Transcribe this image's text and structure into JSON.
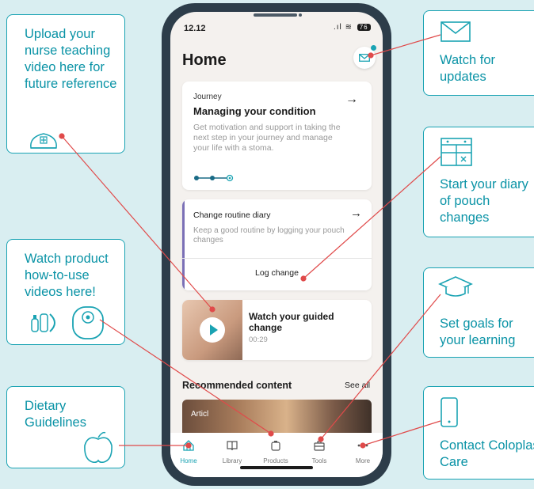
{
  "phone": {
    "status_time": "12.12",
    "battery": "76",
    "page_title": "Home",
    "journey_card": {
      "label": "Journey",
      "title": "Managing your condition",
      "description": "Get motivation and support in taking the next step in your journey and manage your life with a stoma."
    },
    "diary_card": {
      "title": "Change routine diary",
      "description": "Keep a good routine by logging your pouch changes",
      "action": "Log change"
    },
    "video_card": {
      "title": "Watch your guided change",
      "duration": "00:29"
    },
    "recommended": {
      "title": "Recommended content",
      "see_all": "See all",
      "item_label": "Articl"
    },
    "tabs": [
      "Home",
      "Library",
      "Products",
      "Tools",
      "More"
    ]
  },
  "callouts": {
    "upload": "Upload your nurse teaching video here for future reference",
    "watch_product": "Watch product how-to-use videos here!",
    "dietary": "Dietary Guidelines",
    "updates": "Watch for updates",
    "diary": "Start your diary of pouch changes",
    "goals": "Set goals for your learning",
    "contact": "Contact Coloplast Care"
  },
  "colors": {
    "accent": "#1aa3b3",
    "connector": "#e04a4a",
    "diary_accent": "#7b70b6",
    "background": "#d9eef1"
  }
}
